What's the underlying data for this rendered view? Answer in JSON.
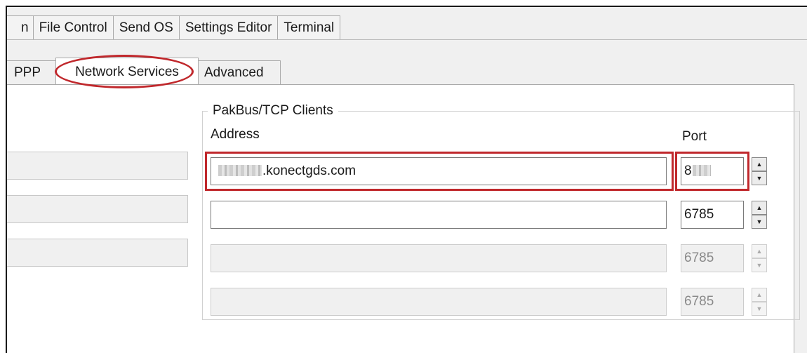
{
  "top_tabs": [
    "n",
    "File Control",
    "Send OS",
    "Settings Editor",
    "Terminal"
  ],
  "inner_tabs": {
    "ppp": "PPP",
    "network_services": "Network Services",
    "advanced": "Advanced"
  },
  "pakbus_group": {
    "title": "PakBus/TCP Clients",
    "address_header": "Address",
    "port_header": "Port",
    "rows": [
      {
        "address": ".konectgds.com",
        "port": "8",
        "enabled": true
      },
      {
        "address": "",
        "port": "6785",
        "enabled": true
      },
      {
        "address": "",
        "port": "6785",
        "enabled": false
      },
      {
        "address": "",
        "port": "6785",
        "enabled": false
      }
    ]
  },
  "colors": {
    "highlight": "#c0282c",
    "panel": "#f0f0f0"
  },
  "icons": {
    "spin_up": "▲",
    "spin_down": "▼"
  }
}
